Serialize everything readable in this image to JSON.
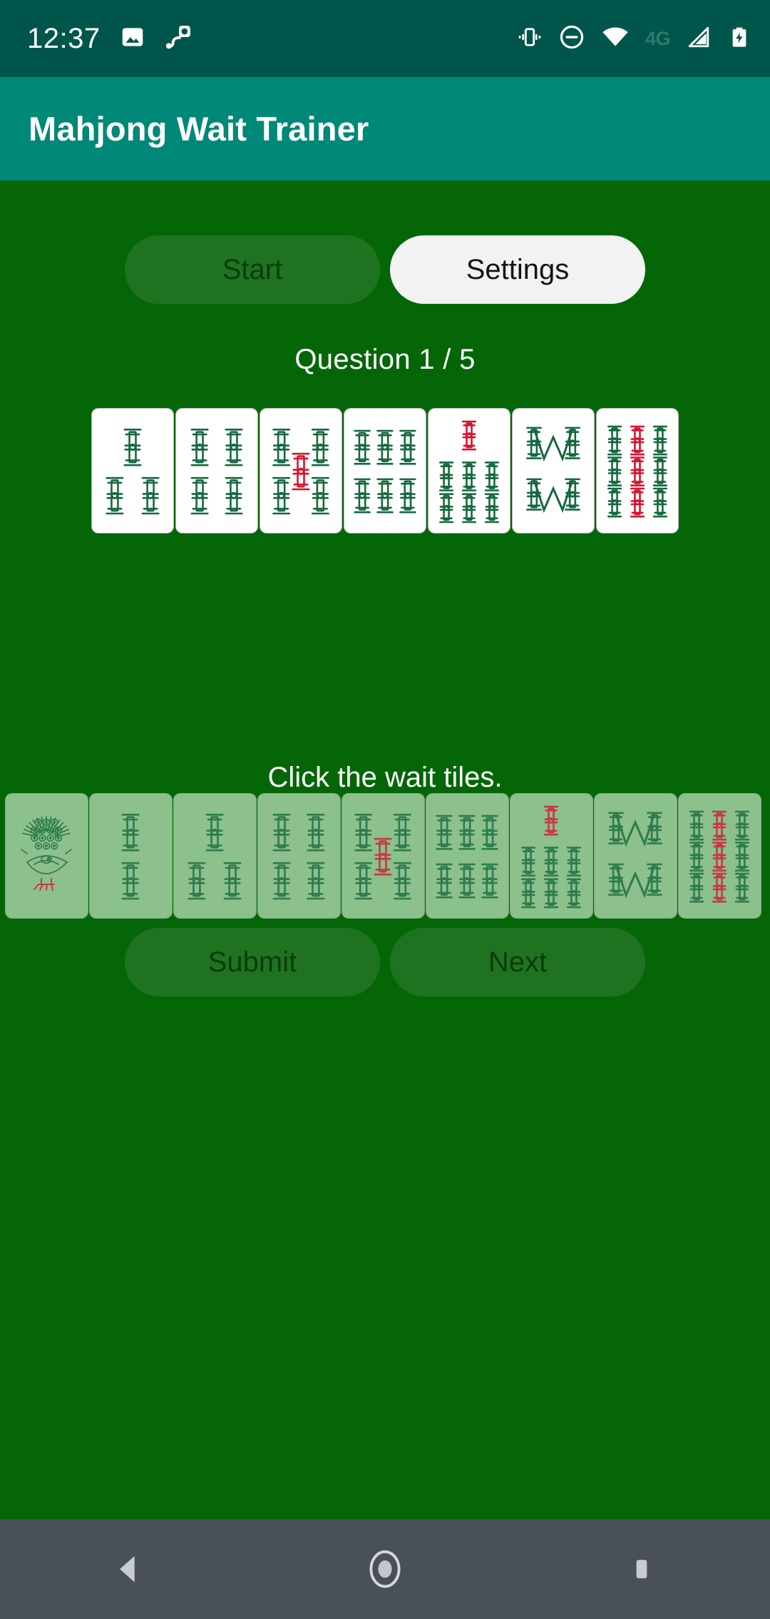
{
  "status_bar": {
    "time": "12:37",
    "left_icons": [
      "image-icon",
      "screen-record-icon"
    ],
    "right_icons": [
      "vibrate-icon",
      "do-not-disturb-icon",
      "wifi-icon",
      "signal-icon",
      "battery-charging-icon"
    ],
    "network_label": "4G",
    "background": "#00564B"
  },
  "app_bar": {
    "title": "Mahjong Wait Trainer",
    "background": "#008878",
    "text_color": "#ffffff"
  },
  "theme": {
    "page_background": "#056608",
    "disabled_button_bg": "#1f7320",
    "disabled_button_text": "#0b3c0c",
    "light_button_bg": "#f2f2f2",
    "light_button_text": "#141414",
    "tile_face": "#ffffff",
    "tile_answer_face": "#8cc08c",
    "bamboo_green": "#14693c",
    "bamboo_red": "#d81430",
    "nav_bar_bg": "#4a5058"
  },
  "top_controls": {
    "start_label": "Start",
    "start_enabled": false,
    "settings_label": "Settings",
    "settings_enabled": true
  },
  "question": {
    "label": "Question 1 / 5",
    "current": 1,
    "total": 5
  },
  "hand": {
    "tiles": [
      {
        "name": "3-bamboo",
        "suit": "bamboo",
        "value": 3
      },
      {
        "name": "4-bamboo",
        "suit": "bamboo",
        "value": 4
      },
      {
        "name": "5-bamboo",
        "suit": "bamboo",
        "value": 5
      },
      {
        "name": "6-bamboo",
        "suit": "bamboo",
        "value": 6
      },
      {
        "name": "7-bamboo",
        "suit": "bamboo",
        "value": 7
      },
      {
        "name": "8-bamboo",
        "suit": "bamboo",
        "value": 8
      },
      {
        "name": "9-bamboo",
        "suit": "bamboo",
        "value": 9
      }
    ]
  },
  "prompt": {
    "text": "Click the wait tiles."
  },
  "answer_choices": {
    "tiles": [
      {
        "name": "1-bamboo",
        "suit": "bamboo",
        "value": 1,
        "selected": false
      },
      {
        "name": "2-bamboo",
        "suit": "bamboo",
        "value": 2,
        "selected": false
      },
      {
        "name": "3-bamboo",
        "suit": "bamboo",
        "value": 3,
        "selected": false
      },
      {
        "name": "4-bamboo",
        "suit": "bamboo",
        "value": 4,
        "selected": false
      },
      {
        "name": "5-bamboo",
        "suit": "bamboo",
        "value": 5,
        "selected": false
      },
      {
        "name": "6-bamboo",
        "suit": "bamboo",
        "value": 6,
        "selected": false
      },
      {
        "name": "7-bamboo",
        "suit": "bamboo",
        "value": 7,
        "selected": false
      },
      {
        "name": "8-bamboo",
        "suit": "bamboo",
        "value": 8,
        "selected": false
      },
      {
        "name": "9-bamboo",
        "suit": "bamboo",
        "value": 9,
        "selected": false
      }
    ]
  },
  "bottom_controls": {
    "submit_label": "Submit",
    "submit_enabled": false,
    "next_label": "Next",
    "next_enabled": false
  },
  "nav_bar": {
    "back": "back-icon",
    "home": "home-icon",
    "recents": "recents-icon"
  }
}
